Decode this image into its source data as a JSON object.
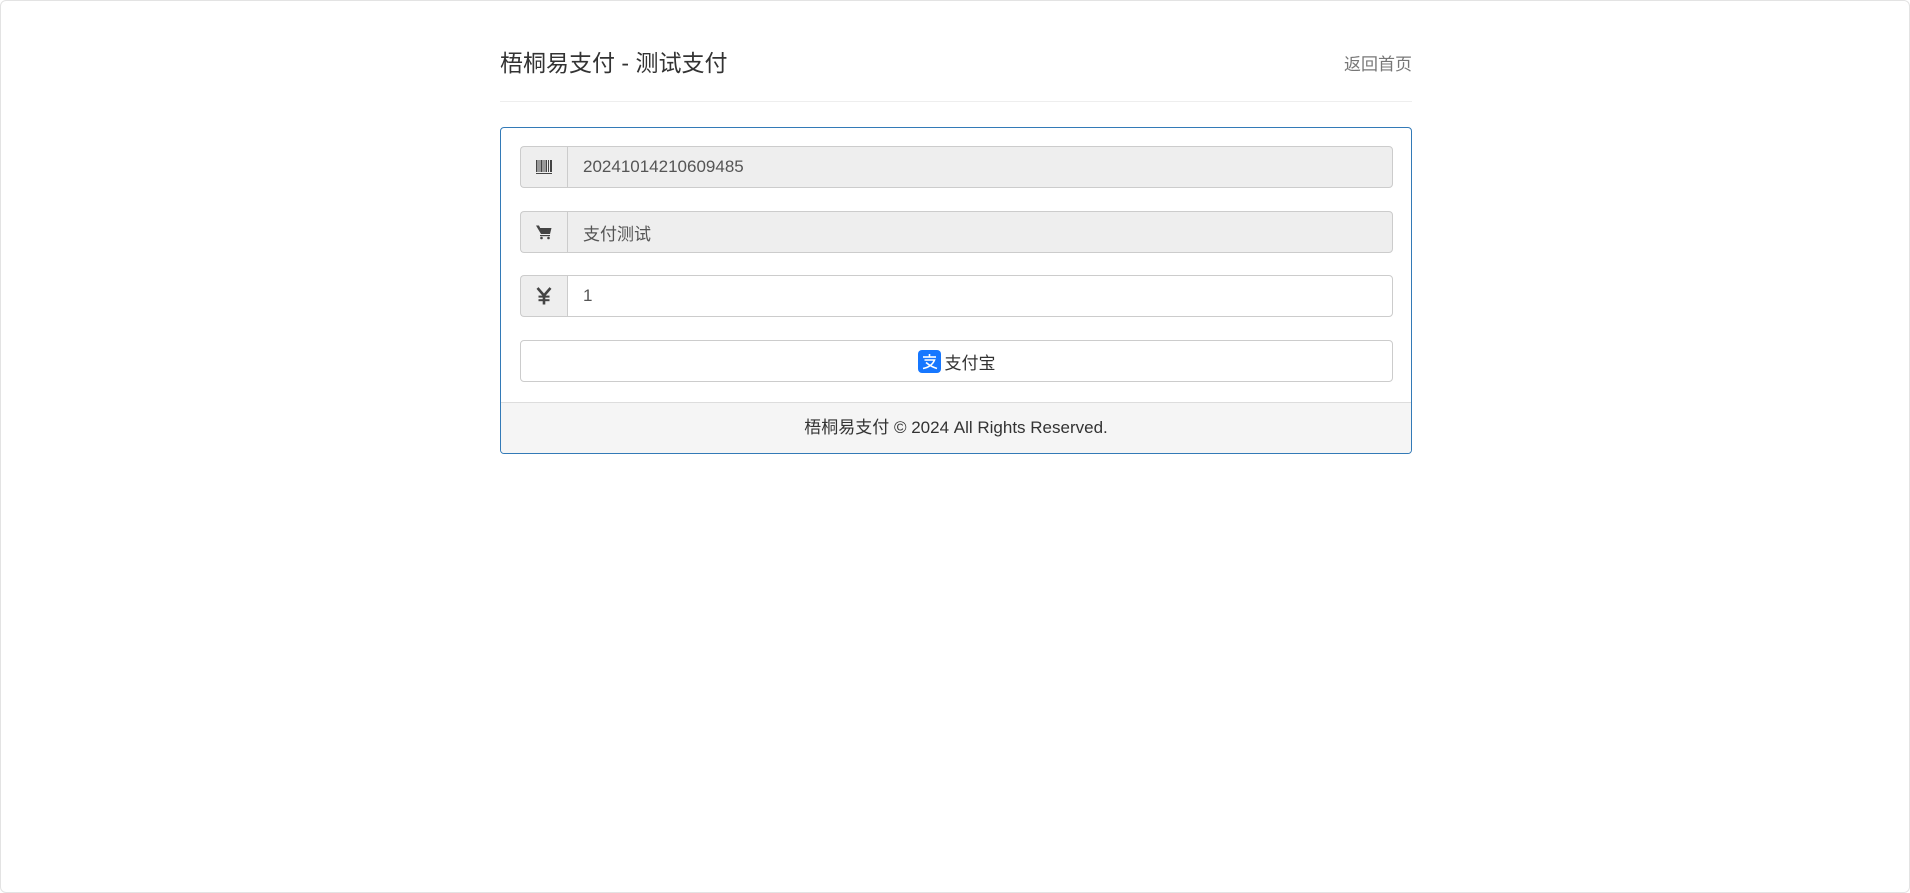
{
  "header": {
    "title": "梧桐易支付 - 测试支付",
    "home_link": "返回首页"
  },
  "form": {
    "order_number": {
      "icon": "barcode-icon",
      "value": "20241014210609485"
    },
    "product_name": {
      "icon": "shopping-cart-icon",
      "value": "支付测试"
    },
    "amount": {
      "icon": "yen-icon",
      "value": "1"
    },
    "pay_button": {
      "icon": "alipay-icon",
      "label": "支付宝"
    }
  },
  "footer": {
    "text": "梧桐易支付 © 2024 All Rights Reserved."
  },
  "colors": {
    "panel_border": "#337ab7",
    "alipay_blue": "#1677ff",
    "addon_bg": "#eeeeee"
  }
}
